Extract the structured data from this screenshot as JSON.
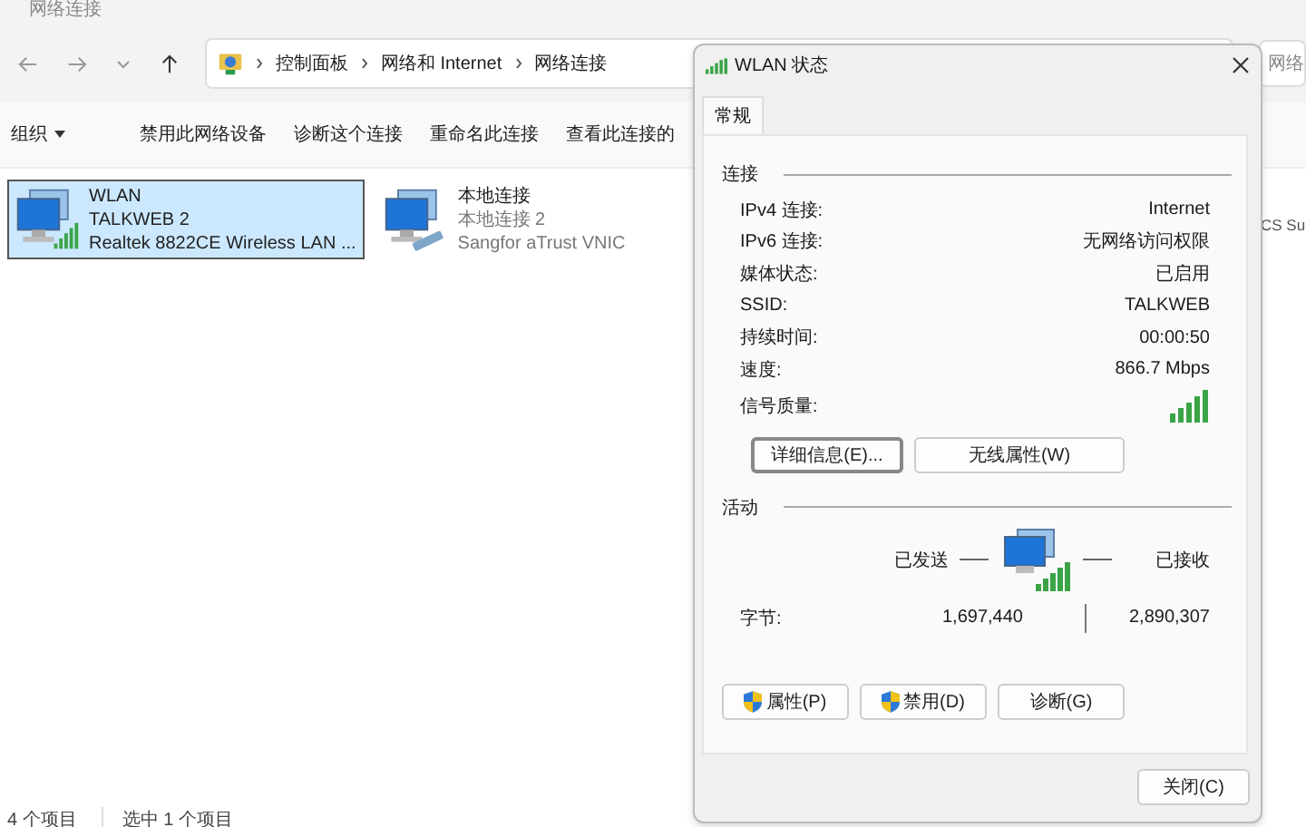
{
  "explorer": {
    "title": "网络连接",
    "breadcrumb": [
      "控制面板",
      "网络和 Internet",
      "网络连接"
    ],
    "search_placeholder": "网络",
    "toolbar": [
      {
        "label": "组织",
        "kind": "menu"
      },
      {
        "label": "禁用此网络设备",
        "kind": "action"
      },
      {
        "label": "诊断这个连接",
        "kind": "action"
      },
      {
        "label": "重命名此连接",
        "kind": "action"
      },
      {
        "label": "查看此连接的",
        "kind": "action"
      }
    ],
    "connections": [
      {
        "name": "WLAN",
        "network": "TALKWEB 2",
        "adapter": "Realtek 8822CE Wireless LAN ...",
        "kind": "wifi",
        "selected": true
      },
      {
        "name": "本地连接",
        "network": "本地连接 2",
        "adapter": "Sangfor aTrust VNIC",
        "kind": "vpn",
        "selected": false
      }
    ],
    "partial_item_text": "CS Su",
    "status_bar": [
      "4 个项目",
      "选中 1 个项目"
    ]
  },
  "dialog": {
    "title": "WLAN 状态",
    "tabs": [
      {
        "label": "常规",
        "selected": true
      }
    ],
    "connection_heading": "连接",
    "fields": [
      {
        "label": "IPv4 连接:",
        "value": "Internet"
      },
      {
        "label": "IPv6 连接:",
        "value": "无网络访问权限"
      },
      {
        "label": "媒体状态:",
        "value": "已启用"
      },
      {
        "label": "SSID:",
        "value": "TALKWEB"
      },
      {
        "label": "持续时间:",
        "value": "00:00:50"
      },
      {
        "label": "速度:",
        "value": "866.7 Mbps"
      }
    ],
    "signal_label": "信号质量:",
    "detail_buttons": [
      {
        "label": "详细信息(E)...",
        "default": true
      },
      {
        "label": "无线属性(W)",
        "default": false
      }
    ],
    "activity_heading": "活动",
    "sent_label": "已发送",
    "received_label": "已接收",
    "bytes_label": "字节:",
    "bytes_sent": "1,697,440",
    "bytes_received": "2,890,307",
    "action_buttons": [
      {
        "label": "属性(P)",
        "shield": true
      },
      {
        "label": "禁用(D)",
        "shield": true
      },
      {
        "label": "诊断(G)",
        "shield": false
      }
    ],
    "close_button": "关闭(C)"
  }
}
